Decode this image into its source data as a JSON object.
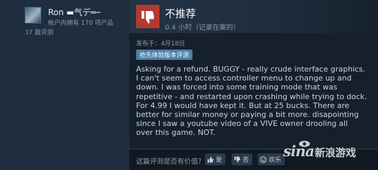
{
  "reviewer": {
    "name": "Ron ▬气デ═─",
    "products_owned": "帐户内拥有 170 项产品",
    "reviews_count": "37 篇评测"
  },
  "review": {
    "verdict": "不推荐",
    "hours": "0.4 小时（记录在案的）",
    "posted": "发布于：4月18日",
    "early_access_badge": "抢先体验版本评测",
    "text": "Asking for a refund. BUGGY - really crude interface graphics. I can't seem to access controller menu to change up and down. I was forced into some training mode that was repetitive - and restarted upon crashing while trying to dock. For 4.99 I would have kept it. But at 25 bucks. There are better for similar money or paying a bit more. disapointing since I saw a youtube video of a VIVE owner drooling all over this game. NOT."
  },
  "helpful": {
    "question": "这篇评测是否有价值？",
    "yes_label": "是",
    "no_label": "否",
    "funny_label": "欢乐"
  },
  "watermark": {
    "brand_latin": "sina",
    "brand_name": "新浪游戏"
  },
  "colors": {
    "background": "#1b2838",
    "negative_verdict": "#b33a30",
    "badge": "#4d7fa7"
  },
  "icons": [
    "thumbs-down-icon",
    "thumbs-up-icon",
    "smiley-icon"
  ]
}
